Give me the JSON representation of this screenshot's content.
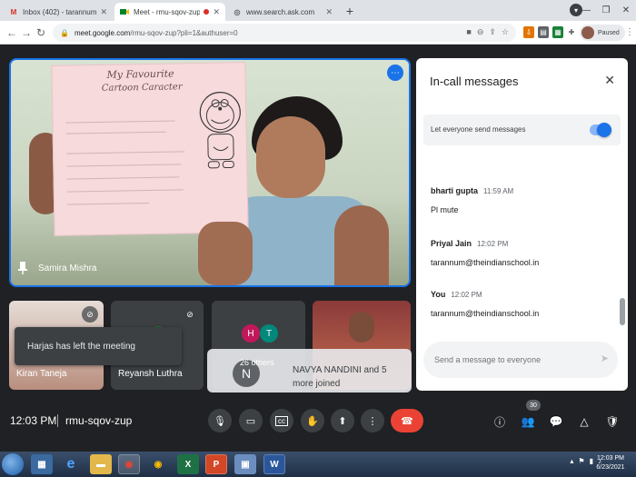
{
  "browser": {
    "tabs": [
      {
        "title": "Inbox (402) - tarannum@theindi",
        "favicon": "gmail-icon",
        "active": false
      },
      {
        "title": "Meet - rmu-sqov-zup",
        "favicon": "meet-icon",
        "active": true
      },
      {
        "title": "www.search.ask.com",
        "favicon": "globe-icon",
        "active": false
      }
    ],
    "url_host": "meet.google.com",
    "url_path": "/rmu-sqov-zup?pli=1&authuser=0",
    "profile_label": "Paused"
  },
  "main_tile": {
    "participant_name": "Samira Mishra",
    "paper_title": "My Favourite",
    "paper_subtitle": "Cartoon Caracter"
  },
  "tiles": [
    {
      "name": "Kiran Taneja",
      "muted": true
    },
    {
      "name": "Reyansh Luthra",
      "muted": true
    },
    {
      "name": "",
      "avatars": [
        "H",
        "T"
      ]
    },
    {
      "name": "NAVYA NANDINI"
    }
  ],
  "toast": {
    "text": "Harjas has left the meeting"
  },
  "others": {
    "initial": "N",
    "count_label": "26 others",
    "joined_text": "NAVYA NANDINI and 5 more joined"
  },
  "chat": {
    "title": "In-call messages",
    "setting_label": "Let everyone send messages",
    "setting_on": true,
    "messages": [
      {
        "sender": "bharti gupta",
        "time": "11:59 AM",
        "text": "Pl mute"
      },
      {
        "sender": "Priyal Jain",
        "time": "12:02 PM",
        "text": "tarannum@theindianschool.in"
      },
      {
        "sender": "You",
        "time": "12:02 PM",
        "text": "tarannum@theindianschool.in"
      }
    ],
    "compose_placeholder": "Send a message to everyone"
  },
  "controls": {
    "time": "12:03 PM",
    "meeting_code": "rmu-sqov-zup",
    "people_count": "30"
  },
  "taskbar": {
    "clock_time": "12:03 PM",
    "clock_date": "6/23/2021"
  },
  "colors": {
    "accent": "#1a73e8",
    "end_call": "#ea4335",
    "meet_bg": "#202124"
  }
}
